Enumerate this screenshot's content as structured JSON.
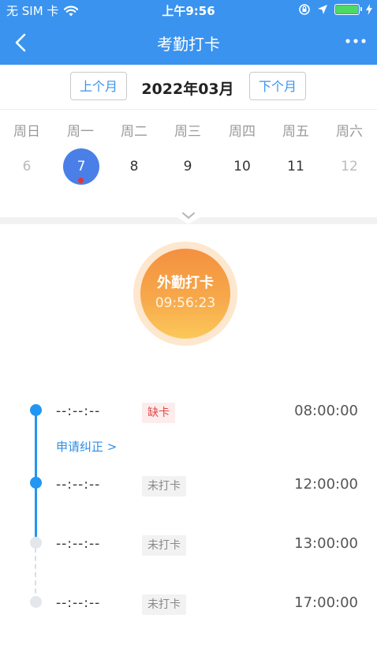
{
  "status": {
    "carrier": "无 SIM 卡",
    "time": "上午9:56"
  },
  "nav": {
    "title": "考勤打卡"
  },
  "month": {
    "prev": "上个月",
    "label": "2022年03月",
    "next": "下个月"
  },
  "weekdays": [
    "周日",
    "周一",
    "周二",
    "周三",
    "周四",
    "周五",
    "周六"
  ],
  "dates": [
    {
      "day": "6",
      "state": "muted"
    },
    {
      "day": "7",
      "state": "selected",
      "has_dot": true
    },
    {
      "day": "8",
      "state": "normal"
    },
    {
      "day": "9",
      "state": "normal"
    },
    {
      "day": "10",
      "state": "normal"
    },
    {
      "day": "11",
      "state": "normal"
    },
    {
      "day": "12",
      "state": "muted"
    }
  ],
  "punch": {
    "label": "外勤打卡",
    "time": "09:56:23"
  },
  "records": [
    {
      "record": "--:--:--",
      "status": "缺卡",
      "status_type": "missing",
      "scheduled": "08:00:00",
      "node": "active"
    },
    {
      "record": "--:--:--",
      "status": "未打卡",
      "status_type": "not-punched",
      "scheduled": "12:00:00",
      "node": "active"
    },
    {
      "record": "--:--:--",
      "status": "未打卡",
      "status_type": "not-punched",
      "scheduled": "13:00:00",
      "node": "inactive"
    },
    {
      "record": "--:--:--",
      "status": "未打卡",
      "status_type": "not-punched",
      "scheduled": "17:00:00",
      "node": "inactive"
    }
  ],
  "correction": {
    "label": "申请纠正 >"
  },
  "colors": {
    "primary": "#3a93ee",
    "timeline": "#2196f3",
    "selected_date": "#4b7fe8",
    "punch_orange": "#f49040",
    "missing_red": "#e04848"
  }
}
